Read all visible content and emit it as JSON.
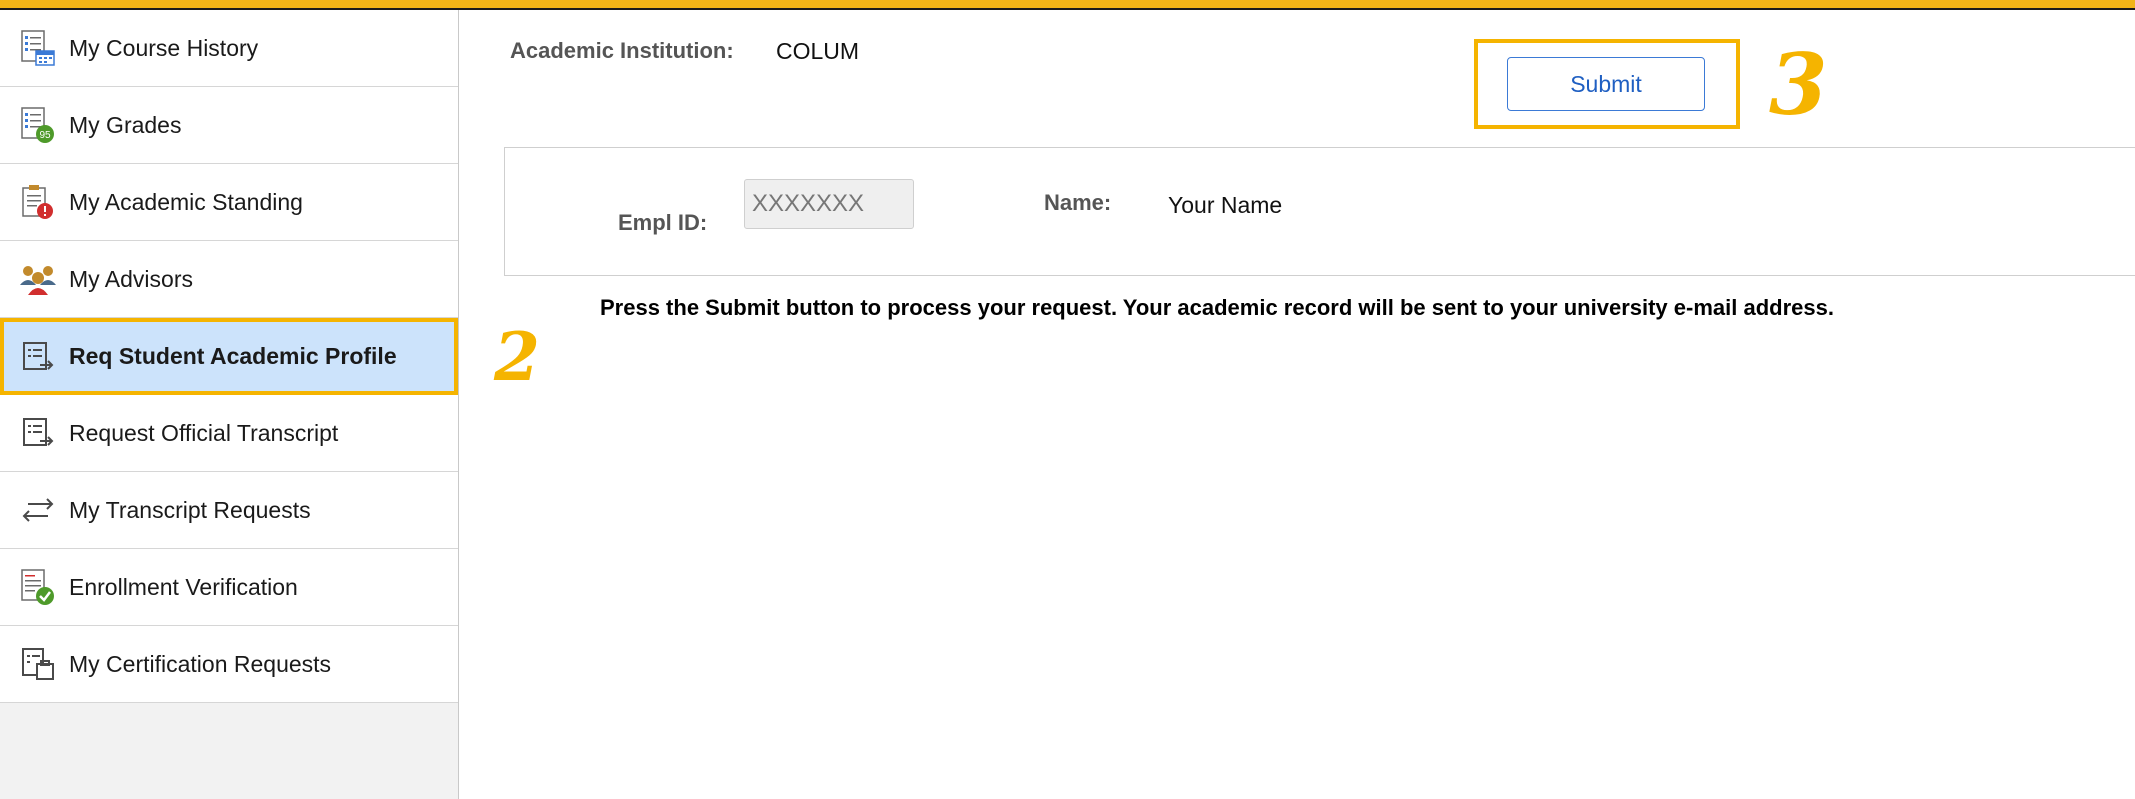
{
  "sidebar": {
    "items": [
      {
        "label": "My Course History",
        "icon": "course-history-icon"
      },
      {
        "label": "My Grades",
        "icon": "grades-icon"
      },
      {
        "label": "My Academic Standing",
        "icon": "academic-standing-icon"
      },
      {
        "label": "My Advisors",
        "icon": "advisors-icon"
      },
      {
        "label": "Req Student Academic Profile",
        "icon": "request-document-icon",
        "active": true
      },
      {
        "label": "Request Official Transcript",
        "icon": "request-document-icon"
      },
      {
        "label": "My Transcript Requests",
        "icon": "transfer-arrows-icon"
      },
      {
        "label": "Enrollment Verification",
        "icon": "verification-check-icon"
      },
      {
        "label": "My Certification Requests",
        "icon": "certification-request-icon"
      }
    ]
  },
  "callouts": {
    "step2": "2",
    "step3": "3"
  },
  "form": {
    "institution_label": "Academic Institution:",
    "institution_value": "COLUM",
    "submit_label": "Submit",
    "empl_label": "Empl ID:",
    "empl_value": "XXXXXXX",
    "name_label": "Name:",
    "name_value": "Your Name"
  },
  "instructions": "Press the Submit button to process your request. Your academic record will be sent to your university e-mail address.",
  "colors": {
    "accent": "#f5b400",
    "active_bg": "#cce3fb",
    "link_blue": "#1f5fc2"
  }
}
